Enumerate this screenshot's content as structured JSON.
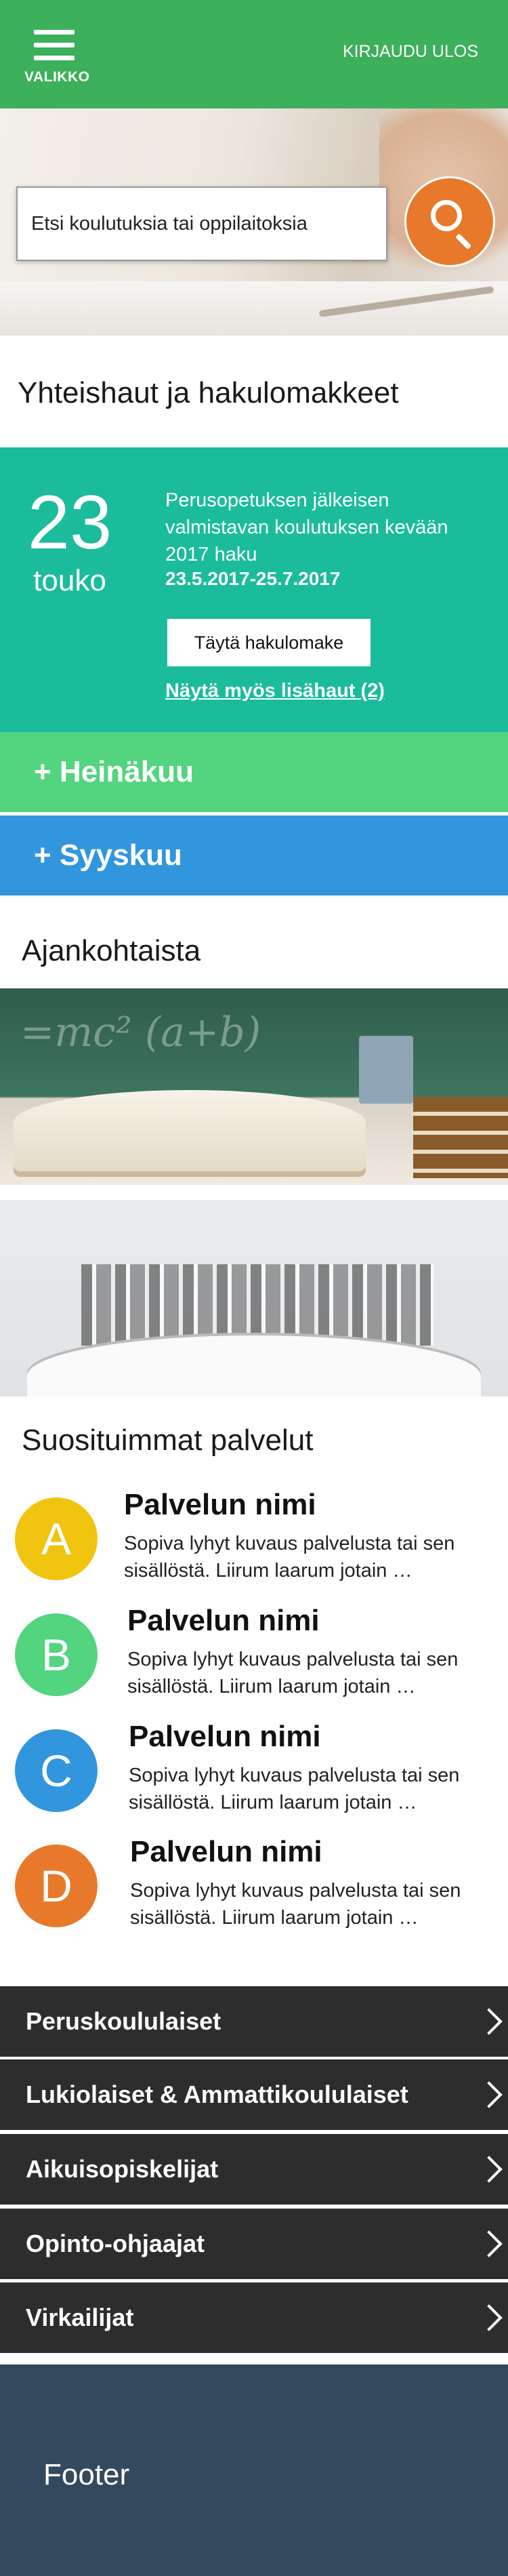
{
  "header": {
    "menu_label": "VALIKKO",
    "logout_label": "KIRJAUDU ULOS",
    "color": "#3cb05b"
  },
  "search": {
    "placeholder": "Etsi koulutuksia tai oppilaitoksia",
    "button_color": "#e8792a"
  },
  "applications": {
    "title": "Yhteishaut ja hakulomakkeet",
    "current": {
      "day": "23",
      "month": "touko",
      "description": "Perusopetuksen jälkeisen valmistavan koulutuksen kevään 2017 haku",
      "dates": "23.5.2017-25.7.2017",
      "fill_button": "Täytä hakulomake",
      "more_link": "Näytä myös lisähaut (2)",
      "color": "#1bbc9b"
    },
    "months": [
      {
        "label": "+ Heinäkuu",
        "color": "#53d47f"
      },
      {
        "label": "+ Syyskuu",
        "color": "#3196dd"
      }
    ]
  },
  "news": {
    "title": "Ajankohtaista",
    "images": [
      {
        "icon": "books-chalkboard-image"
      },
      {
        "icon": "book-city-illustration-image"
      }
    ]
  },
  "services": {
    "title": "Suosituimmat palvelut",
    "items": [
      {
        "letter": "A",
        "color": "#f1c40f",
        "name": "Palvelun nimi",
        "description": "Sopiva lyhyt kuvaus palvelusta tai sen sisällöstä. Liirum laarum jotain …"
      },
      {
        "letter": "B",
        "color": "#53d47f",
        "name": "Palvelun nimi",
        "description": "Sopiva lyhyt kuvaus palvelusta tai sen sisällöstä. Liirum laarum jotain …"
      },
      {
        "letter": "C",
        "color": "#3196dd",
        "name": "Palvelun nimi",
        "description": "Sopiva lyhyt kuvaus palvelusta tai sen sisällöstä. Liirum laarum jotain …"
      },
      {
        "letter": "D",
        "color": "#e8792a",
        "name": "Palvelun nimi",
        "description": "Sopiva lyhyt kuvaus palvelusta tai sen sisällöstä. Liirum laarum jotain …"
      }
    ]
  },
  "audiences": [
    "Peruskoululaiset",
    "Lukiolaiset & Ammattikoululaiset",
    "Aikuisopiskelijat",
    "Opinto-ohjaajat",
    "Virkailijat"
  ],
  "footer": {
    "text": "Footer",
    "color": "#34495e"
  }
}
